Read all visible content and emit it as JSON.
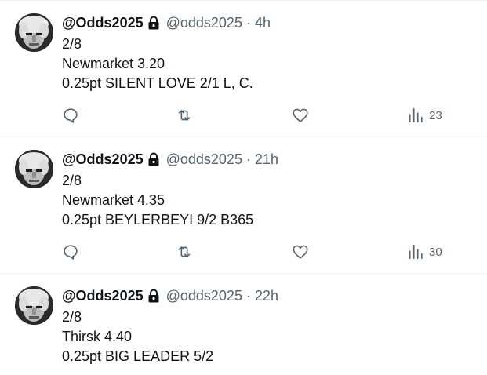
{
  "tweets": [
    {
      "display_name": "@Odds2025",
      "handle": "@odds2025",
      "separator": "·",
      "time": "4h",
      "lines": [
        "2/8",
        "Newmarket 3.20",
        "0.25pt SILENT LOVE 2/1 L, C."
      ],
      "views": "23",
      "show_actions": true
    },
    {
      "display_name": "@Odds2025",
      "handle": "@odds2025",
      "separator": "·",
      "time": "21h",
      "lines": [
        "2/8",
        "Newmarket 4.35",
        "0.25pt BEYLERBEYI 9/2 B365"
      ],
      "views": "30",
      "show_actions": true
    },
    {
      "display_name": "@Odds2025",
      "handle": "@odds2025",
      "separator": "·",
      "time": "22h",
      "lines": [
        "2/8",
        "Thirsk 4.40",
        "0.25pt BIG LEADER 5/2"
      ],
      "views": "",
      "show_actions": false
    }
  ],
  "icons": {
    "avatar": "avatar",
    "lock": "lock-icon",
    "reply": "reply-icon",
    "retweet": "retweet-icon",
    "like": "heart-icon",
    "views": "views-icon"
  },
  "colors": {
    "text": "#0f1419",
    "secondary": "#536471",
    "divider": "#eff3f4"
  }
}
